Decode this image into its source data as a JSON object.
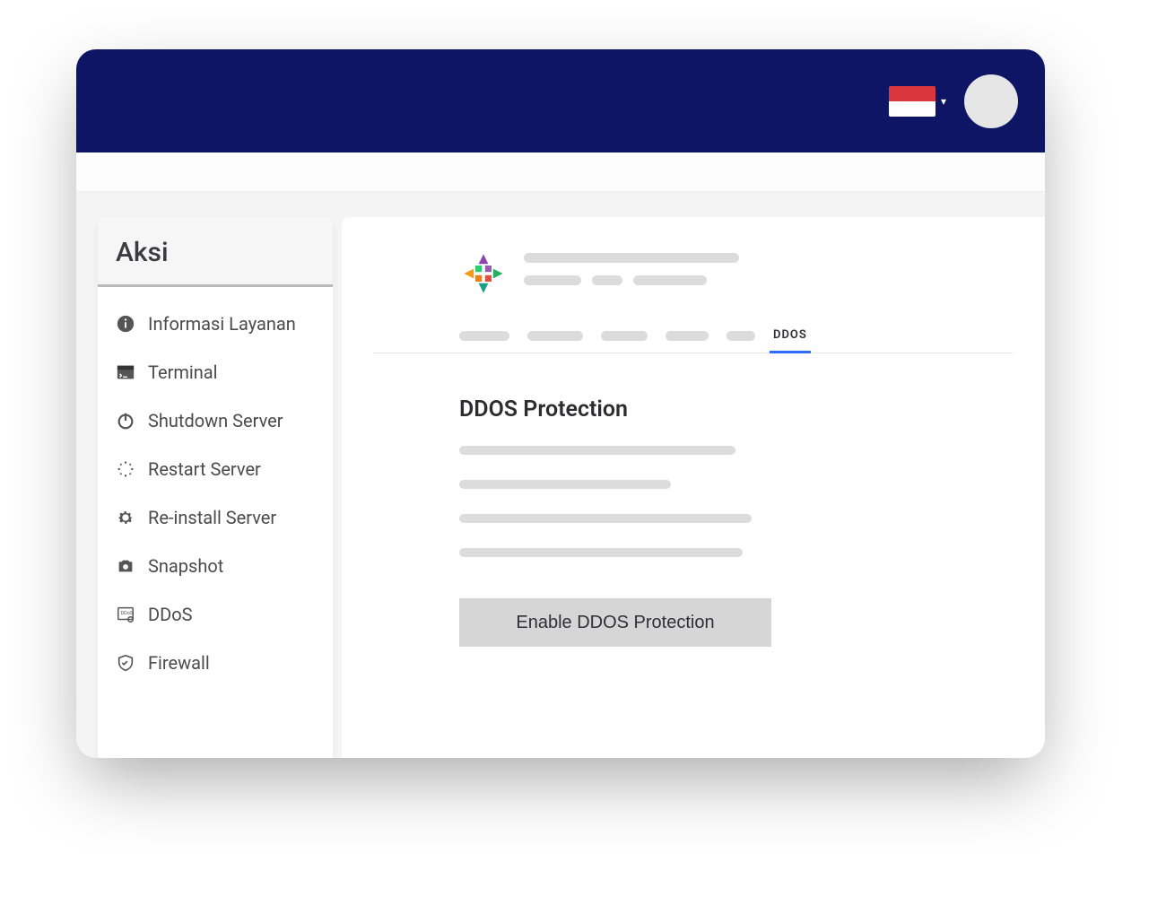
{
  "header": {
    "flag_country": "Indonesia",
    "caret_glyph": "▾"
  },
  "sidebar": {
    "title": "Aksi",
    "items": [
      {
        "label": "Informasi Layanan"
      },
      {
        "label": "Terminal"
      },
      {
        "label": "Shutdown Server"
      },
      {
        "label": "Restart Server"
      },
      {
        "label": "Re-install Server"
      },
      {
        "label": "Snapshot"
      },
      {
        "label": "DDoS"
      },
      {
        "label": "Firewall"
      }
    ]
  },
  "tabs": {
    "active_label": "DDOS"
  },
  "main": {
    "section_title": "DDOS Protection",
    "enable_button": "Enable DDOS Protection"
  }
}
